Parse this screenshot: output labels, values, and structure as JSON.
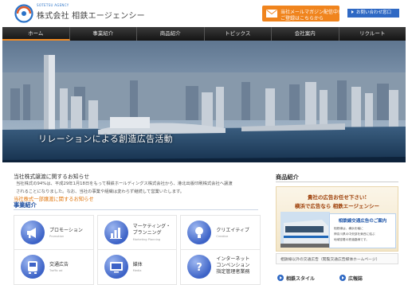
{
  "header": {
    "logo_sub": "SOTETSU AGENCY",
    "logo_name": "株式会社 相鉄エージェンシー",
    "mailmag_line1": "当社メールマガジン配信中!",
    "mailmag_line2": "ご登録はこちらから",
    "contact_label": "お問い合わせ窓口"
  },
  "nav": {
    "items": [
      "ホーム",
      "事業紹介",
      "商品紹介",
      "トピックス",
      "会社案内",
      "リクルート"
    ],
    "active_index": 0
  },
  "hero": {
    "caption": "リレーションによる創造広告活動"
  },
  "news": {
    "title": "当社株式譲渡に関するお知らせ",
    "body_line1": "当社株式の94%は、平成29年1月18日をもって相鉄ホールディングス株式会社から、港北出版印刷株式会社へ譲渡",
    "body_line2": "されることになりました。なお、当社の事業や組織は変わらず継続して営業いたします。",
    "link": "当社株式一部譲渡に関するお知らせ"
  },
  "services": {
    "heading": "事業紹介",
    "items": [
      {
        "title": "プロモーション",
        "title2": "",
        "title3": "",
        "en": "Promotion",
        "icon": "megaphone-icon"
      },
      {
        "title": "マーケティング・",
        "title2": "プランニング",
        "title3": "",
        "en": "Marketing Planning",
        "icon": "bar-chart-icon"
      },
      {
        "title": "クリエイティブ",
        "title2": "",
        "title3": "",
        "en": "Creative",
        "icon": "lightbulb-icon"
      },
      {
        "title": "交通広告",
        "title2": "",
        "title3": "",
        "en": "Traffic ad",
        "icon": "train-icon"
      },
      {
        "title": "媒体",
        "title2": "",
        "title3": "",
        "en": "Media",
        "icon": "tv-icon"
      },
      {
        "title": "インターネット",
        "title2": "コンベンション",
        "title3": "指定管理者業務",
        "en": "",
        "icon": "question-icon"
      }
    ]
  },
  "sidebar": {
    "heading": "商品紹介",
    "ad_line1": "貴社の広告お任せ下さい!",
    "ad_line2": "横浜で広告なら 相鉄エージェンシー",
    "ad_card_title": "相鉄線交通広告のご案内",
    "ad_card_body1": "相鉄線は、横浜を軸に",
    "ad_card_body2": "神奈川県の中央部を東西に結ぶ",
    "ad_card_body3": "地域密着の鉄道路線です。",
    "caption": "相鉄線以外の交通広告（閲覧交通広告媒体ホームページ）",
    "link_style": "相鉄スタイル",
    "link_ad": "広報誌"
  },
  "colors": {
    "accent_orange": "#f0841d",
    "button_blue": "#2f69c4",
    "nav_dark": "#1f1f1f",
    "heading_blue": "#1f4fa0"
  }
}
